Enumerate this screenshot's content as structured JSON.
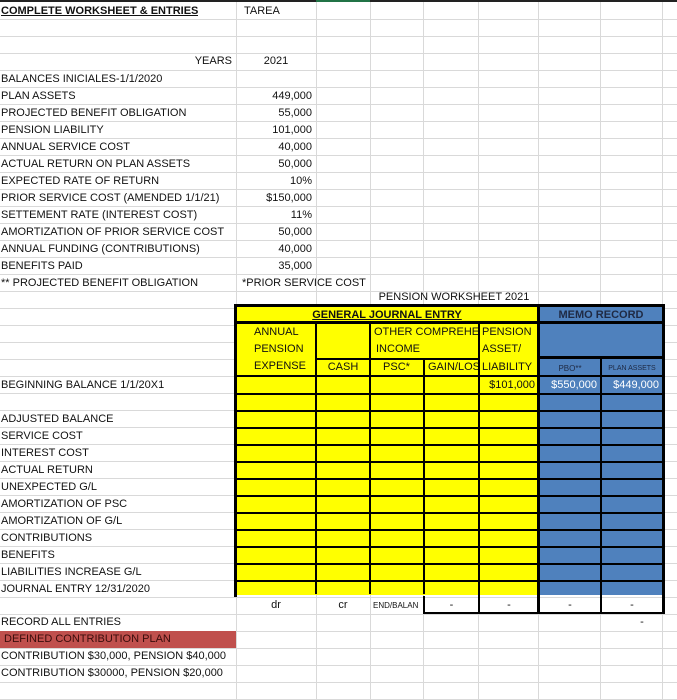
{
  "sheet": {
    "title": "COMPLETE WORKSHEET & ENTRIES",
    "tarea": "TAREA",
    "years_label": "YEARS",
    "year": "2021"
  },
  "givens": [
    {
      "label": "BALANCES INICIALES-1/1/2020",
      "value": ""
    },
    {
      "label": "PLAN ASSETS",
      "value": "449,000"
    },
    {
      "label": "PROJECTED BENEFIT OBLIGATION",
      "value": "55,000"
    },
    {
      "label": "PENSION LIABILITY",
      "value": "101,000"
    },
    {
      "label": "ANNUAL SERVICE COST",
      "value": "40,000"
    },
    {
      "label": "ACTUAL RETURN ON PLAN ASSETS",
      "value": "50,000"
    },
    {
      "label": "EXPECTED RATE OF RETURN",
      "value": "10%"
    },
    {
      "label": "PRIOR SERVICE COST (AMENDED 1/1/21)",
      "value": "$150,000"
    },
    {
      "label": "SETTEMENT RATE (INTEREST COST)",
      "value": "11%"
    },
    {
      "label": "AMORTIZATION OF PRIOR SERVICE COST",
      "value": "50,000"
    },
    {
      "label": "ANNUAL FUNDING (CONTRIBUTIONS)",
      "value": "40,000"
    },
    {
      "label": "BENEFITS PAID",
      "value": "35,000"
    },
    {
      "label": "** PROJECTED BENEFIT OBLIGATION",
      "value": "*PRIOR SERVICE COST"
    }
  ],
  "worksheet": {
    "title": "PENSION WORKSHEET 2021",
    "gje_header": "GENERAL JOURNAL ENTRY",
    "memo_header": "MEMO RECORD",
    "col_headers": {
      "annual_pension_expense": [
        "ANNUAL",
        "PENSION",
        "EXPENSE"
      ],
      "cash": "CASH",
      "oci": [
        "OTHER COMPREHEN",
        "INCOME"
      ],
      "psc": "PSC*",
      "gain_loss": "GAIN/LOS",
      "pension_asset_liability": [
        "PENSION",
        "ASSET/",
        "LIABILITY"
      ],
      "pbo": "PBO**",
      "plan_assets": "PLAN ASSETS"
    },
    "beginning_balance": {
      "label": "BEGINNING BALANCE 1/1/20X1",
      "liability": "$101,000",
      "pbo": "$550,000",
      "plan_assets": "$449,000"
    },
    "row_labels": [
      "",
      "ADJUSTED BALANCE",
      "SERVICE COST",
      "INTEREST COST",
      "ACTUAL RETURN",
      "UNEXPECTED G/L",
      "AMORTIZATION OF PSC",
      "AMORTIZATION OF G/L",
      "CONTRIBUTIONS",
      "BENEFITS",
      "LIABILITIES INCREASE G/L",
      "JOURNAL ENTRY 12/31/2020"
    ],
    "footer": {
      "dr": "dr",
      "cr": "cr",
      "end_balance": "END/BALAN",
      "dash": "-"
    }
  },
  "bottom": {
    "record_all": "RECORD ALL ENTRIES",
    "record_all_dash": "-",
    "dc_plan": "DEFINED CONTRIBUTION PLAN",
    "dc_line1": "CONTRIBUTION $30,000, PENSION $40,000",
    "dc_line2": "CONTRIBUTION $30000, PENSION $20,000"
  },
  "colors": {
    "yellow": "#ffff00",
    "blue": "#4f81bd",
    "red": "#c0504d"
  }
}
